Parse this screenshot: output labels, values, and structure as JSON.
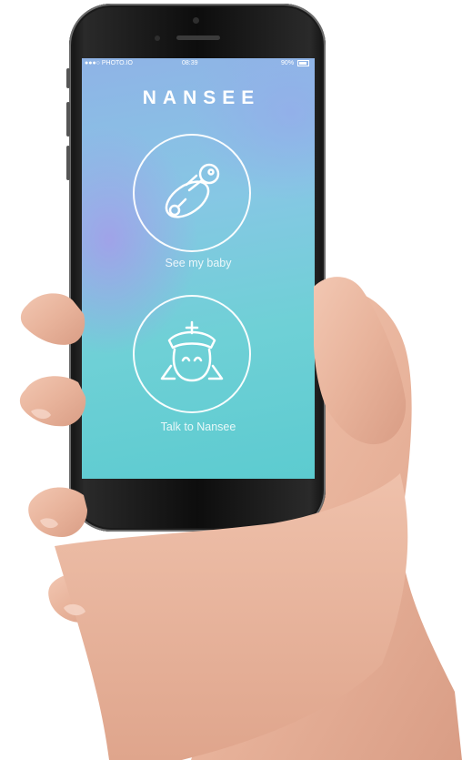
{
  "status_bar": {
    "carrier": "●●●○ PHOTO.IO",
    "time": "08:39",
    "battery": "90%"
  },
  "app": {
    "title": "NANSEE"
  },
  "actions": [
    {
      "label": "See my baby",
      "icon": "baby-rattle-icon"
    },
    {
      "label": "Talk to Nansee",
      "icon": "nurse-icon"
    }
  ],
  "colors": {
    "gradient_top": "#8fb3e6",
    "gradient_bottom": "#5ccbd0",
    "accent_purple": "#aa96eb",
    "text": "#ffffff"
  }
}
